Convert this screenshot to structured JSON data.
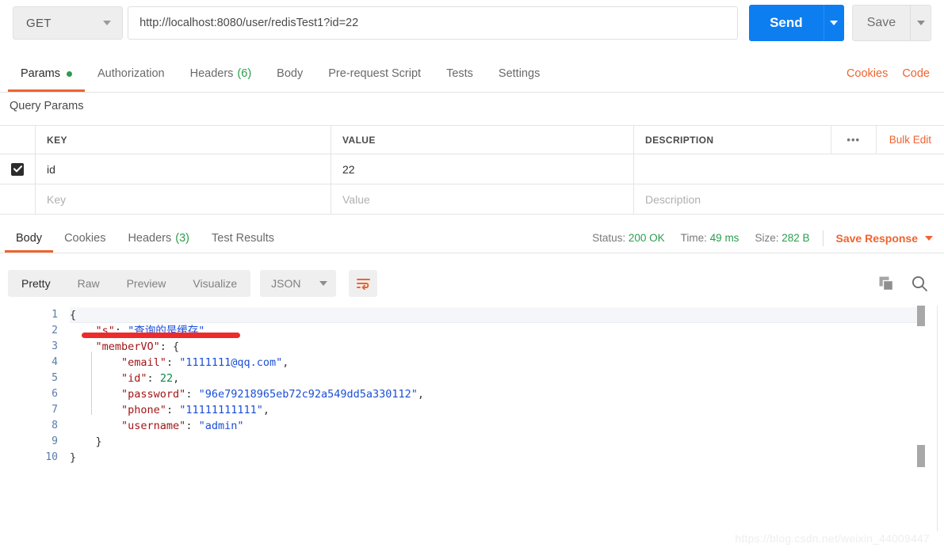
{
  "request_bar": {
    "method": "GET",
    "url": "http://localhost:8080/user/redisTest1?id=22",
    "send_label": "Send",
    "save_label": "Save"
  },
  "request_tabs": {
    "items": [
      {
        "label": "Params",
        "active": true,
        "dot": true
      },
      {
        "label": "Authorization",
        "active": false
      },
      {
        "label": "Headers",
        "active": false,
        "count": "(6)"
      },
      {
        "label": "Body",
        "active": false
      },
      {
        "label": "Pre-request Script",
        "active": false
      },
      {
        "label": "Tests",
        "active": false
      },
      {
        "label": "Settings",
        "active": false
      }
    ],
    "cookies_link": "Cookies",
    "code_link": "Code"
  },
  "query_params": {
    "title": "Query Params",
    "headers": {
      "key": "KEY",
      "value": "VALUE",
      "description": "DESCRIPTION"
    },
    "dots_label": "•••",
    "bulk_edit_label": "Bulk Edit",
    "rows": [
      {
        "checked": true,
        "key": "id",
        "value": "22",
        "description": ""
      }
    ],
    "placeholders": {
      "key": "Key",
      "value": "Value",
      "description": "Description"
    }
  },
  "response": {
    "tabs": [
      {
        "label": "Body",
        "active": true
      },
      {
        "label": "Cookies",
        "active": false
      },
      {
        "label": "Headers",
        "active": false,
        "count": "(3)"
      },
      {
        "label": "Test Results",
        "active": false
      }
    ],
    "status_label": "Status:",
    "status_value": "200 OK",
    "time_label": "Time:",
    "time_value": "49 ms",
    "size_label": "Size:",
    "size_value": "282 B",
    "save_response_label": "Save Response"
  },
  "body_toolbar": {
    "views": [
      {
        "label": "Pretty",
        "active": true
      },
      {
        "label": "Raw",
        "active": false
      },
      {
        "label": "Preview",
        "active": false
      },
      {
        "label": "Visualize",
        "active": false
      }
    ],
    "format": "JSON",
    "wrap_icon": "word-wrap-icon",
    "copy_icon": "copy-icon",
    "search_icon": "search-icon"
  },
  "code_viewer": {
    "line_numbers": [
      "1",
      "2",
      "3",
      "4",
      "5",
      "6",
      "7",
      "8",
      "9",
      "10"
    ],
    "lines": [
      {
        "indent": 0,
        "tokens": [
          {
            "t": "p",
            "v": "{"
          }
        ]
      },
      {
        "indent": 1,
        "tokens": [
          {
            "t": "k",
            "v": "\"s\""
          },
          {
            "t": "p",
            "v": ": "
          },
          {
            "t": "s",
            "v": "\"查询的是缓存\""
          },
          {
            "t": "p",
            "v": ","
          }
        ]
      },
      {
        "indent": 1,
        "tokens": [
          {
            "t": "k",
            "v": "\"memberVO\""
          },
          {
            "t": "p",
            "v": ": {"
          }
        ]
      },
      {
        "indent": 2,
        "tokens": [
          {
            "t": "k",
            "v": "\"email\""
          },
          {
            "t": "p",
            "v": ": "
          },
          {
            "t": "s",
            "v": "\"1111111@qq.com\""
          },
          {
            "t": "p",
            "v": ","
          }
        ]
      },
      {
        "indent": 2,
        "tokens": [
          {
            "t": "k",
            "v": "\"id\""
          },
          {
            "t": "p",
            "v": ": "
          },
          {
            "t": "n",
            "v": "22"
          },
          {
            "t": "p",
            "v": ","
          }
        ]
      },
      {
        "indent": 2,
        "tokens": [
          {
            "t": "k",
            "v": "\"password\""
          },
          {
            "t": "p",
            "v": ": "
          },
          {
            "t": "s",
            "v": "\"96e79218965eb72c92a549dd5a330112\""
          },
          {
            "t": "p",
            "v": ","
          }
        ]
      },
      {
        "indent": 2,
        "tokens": [
          {
            "t": "k",
            "v": "\"phone\""
          },
          {
            "t": "p",
            "v": ": "
          },
          {
            "t": "s",
            "v": "\"11111111111\""
          },
          {
            "t": "p",
            "v": ","
          }
        ]
      },
      {
        "indent": 2,
        "tokens": [
          {
            "t": "k",
            "v": "\"username\""
          },
          {
            "t": "p",
            "v": ": "
          },
          {
            "t": "s",
            "v": "\"admin\""
          }
        ]
      },
      {
        "indent": 1,
        "tokens": [
          {
            "t": "p",
            "v": "}"
          }
        ]
      },
      {
        "indent": 0,
        "tokens": [
          {
            "t": "p",
            "v": "}"
          }
        ]
      }
    ]
  },
  "annotation": {
    "red_underline": "red-underline-on-line-2"
  },
  "watermark": {
    "text": "https://blog.csdn.net/weixin_44009447"
  },
  "colors": {
    "send_blue": "#0d7ef0",
    "accent_orange": "#ef6430",
    "status_green": "#2a9d4e",
    "annotation_red": "#ee2b2b"
  }
}
